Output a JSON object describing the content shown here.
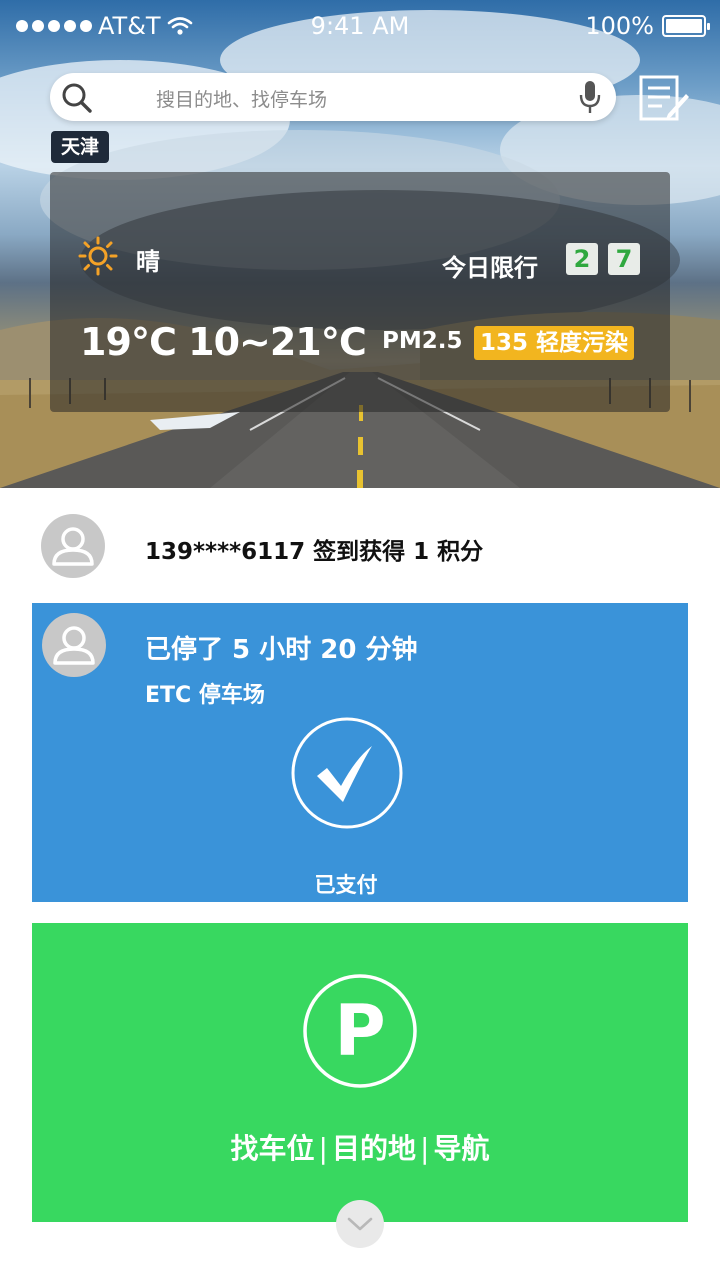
{
  "status_bar": {
    "carrier": "AT&T",
    "time": "9:41 AM",
    "battery": "100%"
  },
  "search": {
    "placeholder": "搜目的地、找停车场"
  },
  "city": "天津",
  "weather": {
    "condition": "晴",
    "temperature": "19℃ 10~21℃",
    "traffic_limit_label": "今日限行",
    "traffic_limit_digits": [
      "2",
      "7"
    ],
    "pm_label": "PM2.5",
    "aqi": "135 轻度污染"
  },
  "checkin": {
    "text": "139****6117 签到获得 1 积分"
  },
  "parking": {
    "duration": "已停了 5 小时 20 分钟",
    "lot": "ETC 停车场",
    "status": "已支付"
  },
  "find": {
    "actions": [
      "找车位",
      "目的地",
      "导航"
    ]
  },
  "colors": {
    "parking_card": "#3a93d9",
    "find_card": "#38d860",
    "aqi_badge": "#f2b51f",
    "limit_digit": "#2fa83f"
  }
}
